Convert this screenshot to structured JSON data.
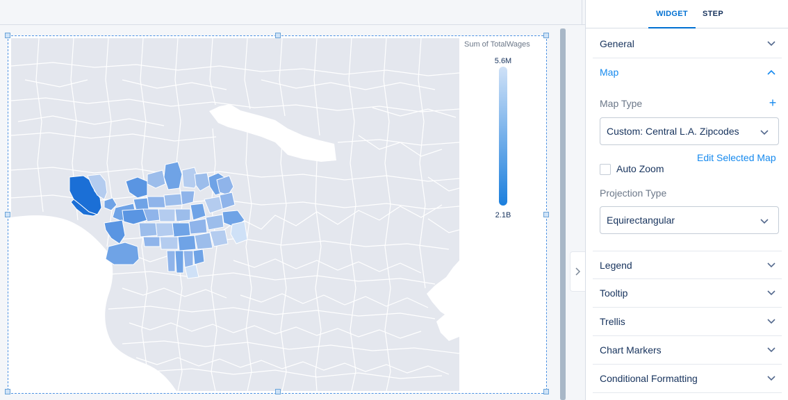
{
  "tabs": {
    "widget": "WIDGET",
    "step": "STEP"
  },
  "legend": {
    "title": "Sum of TotalWages",
    "max": "5.6M",
    "min": "2.1B"
  },
  "sections": {
    "general": "General",
    "map": "Map",
    "legend": "Legend",
    "tooltip": "Tooltip",
    "trellis": "Trellis",
    "chart_markers": "Chart Markers",
    "conditional_formatting": "Conditional Formatting"
  },
  "map_section": {
    "map_type_label": "Map Type",
    "map_type_value": "Custom: Central L.A. Zipcodes",
    "add_symbol": "+",
    "edit_selected_map": "Edit Selected Map",
    "auto_zoom_label": "Auto Zoom",
    "auto_zoom_checked": false,
    "projection_type_label": "Projection Type",
    "projection_type_value": "Equirectangular"
  },
  "colors": {
    "accent": "#0070d2",
    "link": "#1589ee",
    "legend_high": "#cfe1f7",
    "legend_low": "#1b7fdd",
    "map_land": "#e4e7ee",
    "map_water": "#ffffff"
  }
}
